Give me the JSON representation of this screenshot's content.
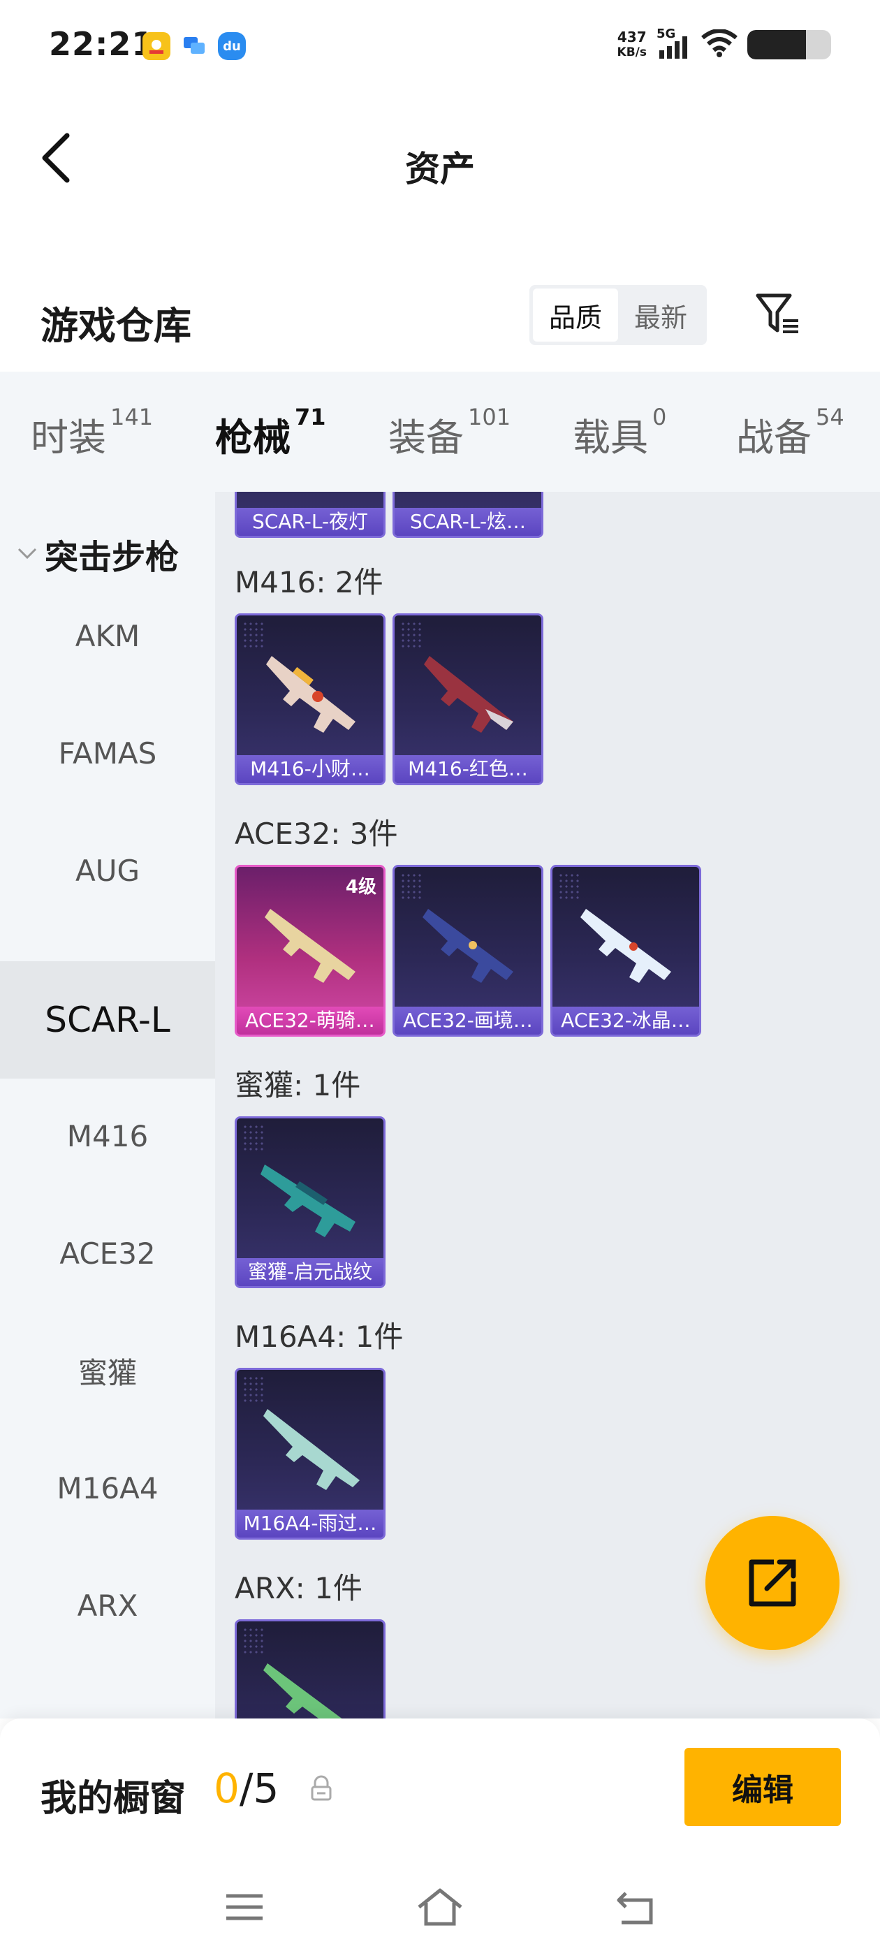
{
  "status_bar": {
    "time": "22:21",
    "net_speed_value": "437",
    "net_speed_unit": "KB/s",
    "network": "5G",
    "apps": [
      {
        "name": "yellow-app-icon",
        "color": "#f7c21a"
      },
      {
        "name": "chat-app-icon",
        "color": "#2a7ff0"
      },
      {
        "name": "du-app-icon",
        "color": "#2a8cf0"
      }
    ],
    "battery_level": 0.7
  },
  "header": {
    "title": "资产"
  },
  "warehouse": {
    "title": "游戏仓库",
    "sort_options": [
      "品质",
      "最新"
    ],
    "sort_selected": "品质"
  },
  "tabs": [
    {
      "label": "时装",
      "count": "141",
      "active": false
    },
    {
      "label": "枪械",
      "count": "71",
      "active": true
    },
    {
      "label": "装备",
      "count": "101",
      "active": false
    },
    {
      "label": "载具",
      "count": "0",
      "active": false
    },
    {
      "label": "战备",
      "count": "54",
      "active": false
    }
  ],
  "sidebar": {
    "group_label": "突击步枪",
    "items": [
      {
        "label": "AKM",
        "active": false
      },
      {
        "label": "FAMAS",
        "active": false
      },
      {
        "label": "AUG",
        "active": false
      },
      {
        "label": "SCAR-L",
        "active": true
      },
      {
        "label": "M416",
        "active": false
      },
      {
        "label": "ACE32",
        "active": false
      },
      {
        "label": "蜜獾",
        "active": false
      },
      {
        "label": "M16A4",
        "active": false
      },
      {
        "label": "ARX",
        "active": false
      }
    ]
  },
  "content": {
    "groups": [
      {
        "label": "",
        "items": [
          {
            "name": "SCAR-L-夜灯",
            "tier": "purple",
            "badge": ""
          },
          {
            "name": "SCAR-L-炫…",
            "tier": "purple",
            "badge": ""
          }
        ]
      },
      {
        "label": "M416: 2件",
        "items": [
          {
            "name": "M416-小财…",
            "tier": "purple",
            "badge": "",
            "gun_color": "#e8d2c6"
          },
          {
            "name": "M416-红色…",
            "tier": "purple",
            "badge": "",
            "gun_color": "#9a3340"
          }
        ]
      },
      {
        "label": "ACE32: 3件",
        "items": [
          {
            "name": "ACE32-萌骑…",
            "tier": "gold",
            "badge": "4级",
            "gun_color": "#e8d4a0"
          },
          {
            "name": "ACE32-画境…",
            "tier": "purple",
            "badge": "",
            "gun_color": "#3b4a9e"
          },
          {
            "name": "ACE32-冰晶…",
            "tier": "purple",
            "badge": "",
            "gun_color": "#e6f0fb"
          }
        ]
      },
      {
        "label": "蜜獾: 1件",
        "items": [
          {
            "name": "蜜獾-启元战纹",
            "tier": "purple",
            "badge": "",
            "gun_color": "#2e9c9a"
          }
        ]
      },
      {
        "label": "M16A4: 1件",
        "items": [
          {
            "name": "M16A4-雨过…",
            "tier": "purple",
            "badge": "",
            "gun_color": "#a8d8d0"
          }
        ]
      },
      {
        "label": "ARX: 1件",
        "items": [
          {
            "name": "",
            "tier": "purple",
            "badge": "",
            "gun_color": "#6cc47a"
          }
        ]
      }
    ]
  },
  "showcase": {
    "label": "我的橱窗",
    "current": "0",
    "separator": "/",
    "total": "5",
    "edit_label": "编辑"
  },
  "colors": {
    "accent": "#ffb300",
    "purple_tier": "#7561d4",
    "gold_tier": "#e24bb8"
  }
}
